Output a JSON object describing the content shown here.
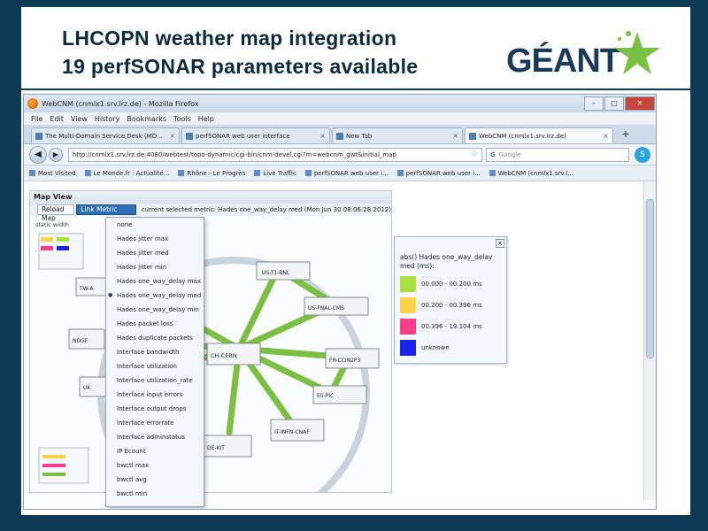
{
  "slide": {
    "title_line1": "LHCOPN weather map integration",
    "title_line2": "19 perfSONAR parameters available",
    "logo_text": "GÉANT"
  },
  "browser": {
    "window_title": "WebCNM (cnmlx1.srv.lrz.de) - Mozilla Firefox",
    "menu": [
      "File",
      "Edit",
      "View",
      "History",
      "Bookmarks",
      "Tools",
      "Help"
    ],
    "tabs": [
      {
        "label": "The Multi-Domain Service Desk (MD..."
      },
      {
        "label": "perfSONAR web user interface"
      },
      {
        "label": "New Tab"
      },
      {
        "label": "WebCNM (cnmlx1.srv.lrz.de)"
      }
    ],
    "url": "http://cnmlx1.srv.lrz.de:4080/webtest/topo-dynamic/cgi-bin/cnm-devel.cgi?m=webcnm_gwt&initial_map",
    "search_placeholder": "Google",
    "search_engine": "G",
    "bookmarks": [
      "Most Visited",
      "Le Monde.fr : Actualité...",
      "Rhône - Le Progrès",
      "Live Traffic",
      "perfSONAR web user i...",
      "perfSONAR web user i...",
      "WebCNM (cnmlx1.srv.l..."
    ]
  },
  "mapview": {
    "header": "Map View",
    "reload_label": "Reload Map",
    "metric_button": "Link Metric Selection",
    "current_metric": "current selected metric: Hades one_way_delay med (Mon Jun 30 08:06:28 2012)",
    "static_width": "static width"
  },
  "metric_menu": {
    "items": [
      "none",
      "Hades jitter max",
      "Hades jitter med",
      "Hades jitter min",
      "Hades one_way_delay max",
      "Hades one_way_delay med",
      "Hades one_way_delay min",
      "Hades packet loss",
      "Hades duplicate packets",
      "Interface bandwidth",
      "Interface utilization",
      "Interface utilization_rate",
      "Interface input errors",
      "Interface output drops",
      "Interface errorrate",
      "Interface adminstatus",
      "IP Ecount",
      "bwctl max",
      "bwctl avg",
      "bwctl min"
    ],
    "selected_index": 5
  },
  "legend": {
    "close": "x",
    "title": "abs() Hades one_way_delay med (ms):",
    "rows": [
      {
        "label": "00.000 - 00.200 ms",
        "color": "#a8e03c"
      },
      {
        "label": "00.200 - 00.396 ms",
        "color": "#ffd24a"
      },
      {
        "label": "00.396 - 19.104 ms",
        "color": "#ff3c8a"
      },
      {
        "label": "unknown",
        "color": "#1a24e8"
      }
    ]
  },
  "map": {
    "node_labels": [
      "US-T1-BNL",
      "US-FNAL-CMS",
      "CH-CERN",
      "FR-CCIN2P3",
      "ES-PIC",
      "IT-INFN-CNAF",
      "DE-KIT",
      "TW-A",
      "NDGF",
      "UK"
    ],
    "link_color": "#7ac143"
  },
  "colors": {
    "background": "#0e3a55",
    "title": "#0c2a40",
    "accent": "#7ac143"
  }
}
